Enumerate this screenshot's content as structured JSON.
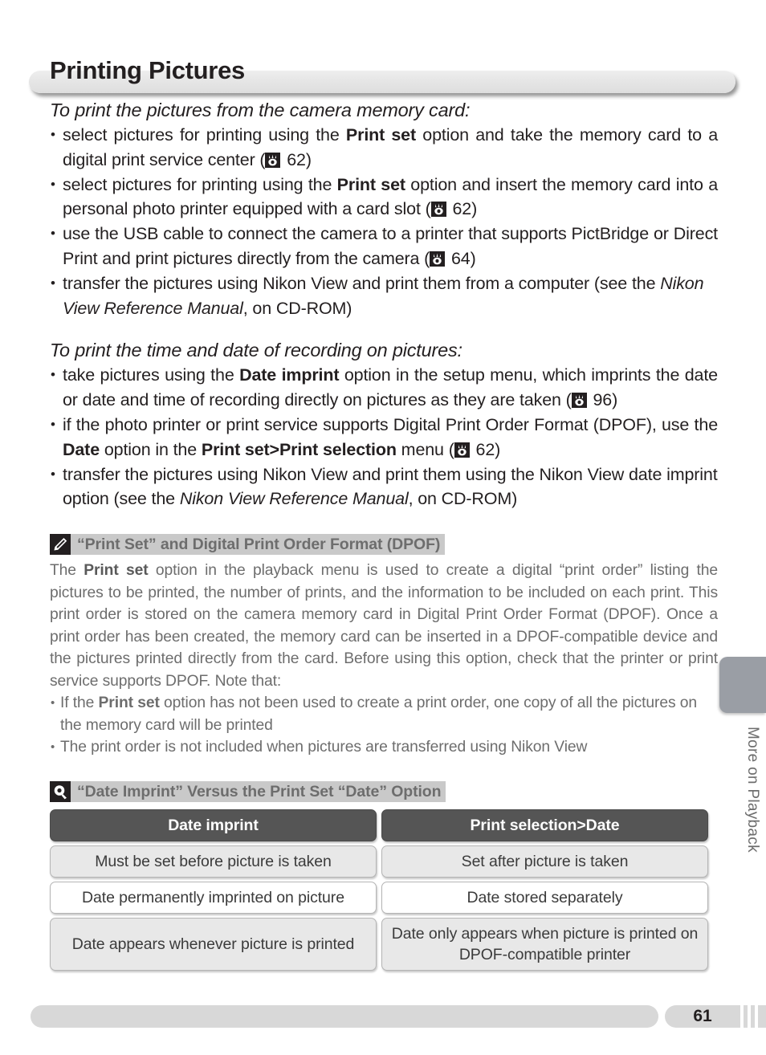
{
  "page": {
    "title": "Printing Pictures",
    "page_number": "61",
    "side_tab_label": "More on Playback"
  },
  "section_one": {
    "heading": "To print the pictures from the camera memory card:",
    "bullets": [
      {
        "parts": [
          {
            "t": "select pictures for printing using the "
          },
          {
            "t": "Print set",
            "s": "b"
          },
          {
            "t": " option and take the memory card to a digital print service center ("
          },
          {
            "t": "pgicon",
            "s": "icon"
          },
          {
            "t": " 62)"
          }
        ]
      },
      {
        "parts": [
          {
            "t": "select pictures for printing using the "
          },
          {
            "t": "Print set",
            "s": "b"
          },
          {
            "t": " option and insert the memory card into a personal photo printer equipped with a card slot ("
          },
          {
            "t": "pgicon",
            "s": "icon"
          },
          {
            "t": " 62)"
          }
        ]
      },
      {
        "parts": [
          {
            "t": "use the USB cable to connect the camera to a printer that supports PictBridge or Direct Print and print pictures directly from the camera ("
          },
          {
            "t": "pgicon",
            "s": "icon"
          },
          {
            "t": " 64)"
          }
        ]
      },
      {
        "parts": [
          {
            "t": "transfer the pictures using Nikon View and print them from a computer (see the "
          },
          {
            "t": "Nikon View Reference Manual",
            "s": "i"
          },
          {
            "t": ", on CD-ROM)"
          }
        ]
      }
    ]
  },
  "section_two": {
    "heading": "To print the time and date of recording on pictures:",
    "bullets": [
      {
        "parts": [
          {
            "t": "take pictures using the "
          },
          {
            "t": "Date imprint",
            "s": "b"
          },
          {
            "t": " option in the setup menu, which imprints the date or date and time of recording directly on pictures as they are taken ("
          },
          {
            "t": "pgicon",
            "s": "icon"
          },
          {
            "t": " 96)"
          }
        ]
      },
      {
        "parts": [
          {
            "t": "if the photo printer or print service supports Digital Print Order Format (DPOF), use the "
          },
          {
            "t": "Date",
            "s": "b"
          },
          {
            "t": " option in the "
          },
          {
            "t": "Print set>Print selection",
            "s": "b"
          },
          {
            "t": " menu ("
          },
          {
            "t": "pgicon",
            "s": "icon"
          },
          {
            "t": " 62)"
          }
        ]
      },
      {
        "parts": [
          {
            "t": "transfer the pictures using Nikon View and print them using the Nikon View date imprint option (see the "
          },
          {
            "t": "Nikon View Reference Manual",
            "s": "i"
          },
          {
            "t": ", on CD-ROM)"
          }
        ]
      }
    ]
  },
  "note_one": {
    "icon": "pencil-icon",
    "title": "“Print Set” and Digital Print Order Format (DPOF)",
    "paragraph_parts": [
      {
        "t": "The "
      },
      {
        "t": "Print set",
        "s": "b"
      },
      {
        "t": " option in the playback menu is used to create a digital “print order” listing the pictures to be printed, the number of prints, and the information to be included on each print.  This print order is stored on the camera memory card in Digital Print Order Format (DPOF).  Once a print order has been created, the memory card can be inserted in a DPOF-compatible device and the pictures printed directly from the card.  Before using this option, check that the printer or print service supports DPOF.  Note that:"
      }
    ],
    "bullets": [
      {
        "parts": [
          {
            "t": "If the "
          },
          {
            "t": "Print set",
            "s": "b"
          },
          {
            "t": " option has not been used to create a print order, one copy of all the pictures on the memory card will be printed"
          }
        ]
      },
      {
        "parts": [
          {
            "t": "The print order is not included when pictures are transferred using Nikon View"
          }
        ]
      }
    ]
  },
  "note_two": {
    "icon": "magnifier-icon",
    "title": "“Date Imprint” Versus the Print Set “Date” Option",
    "table": {
      "headers": [
        "Date imprint",
        "Print selection>Date"
      ],
      "rows": [
        [
          "Must be set before picture is taken",
          "Set after picture is taken"
        ],
        [
          "Date permanently imprinted on picture",
          "Date stored separately"
        ],
        [
          "Date appears whenever picture is printed",
          "Date only appears when picture is printed on DPOF-compatible printer"
        ]
      ]
    }
  },
  "colors": {
    "title_bar": "#e6e6e6",
    "note_title_bg": "#c9c9c9",
    "note_text": "#6d6d6d",
    "table_header_bg": "#555555",
    "table_shade_bg": "#e8e8e8",
    "side_tab": "#9a9ea5",
    "footer_bar": "#d8d8d8"
  }
}
